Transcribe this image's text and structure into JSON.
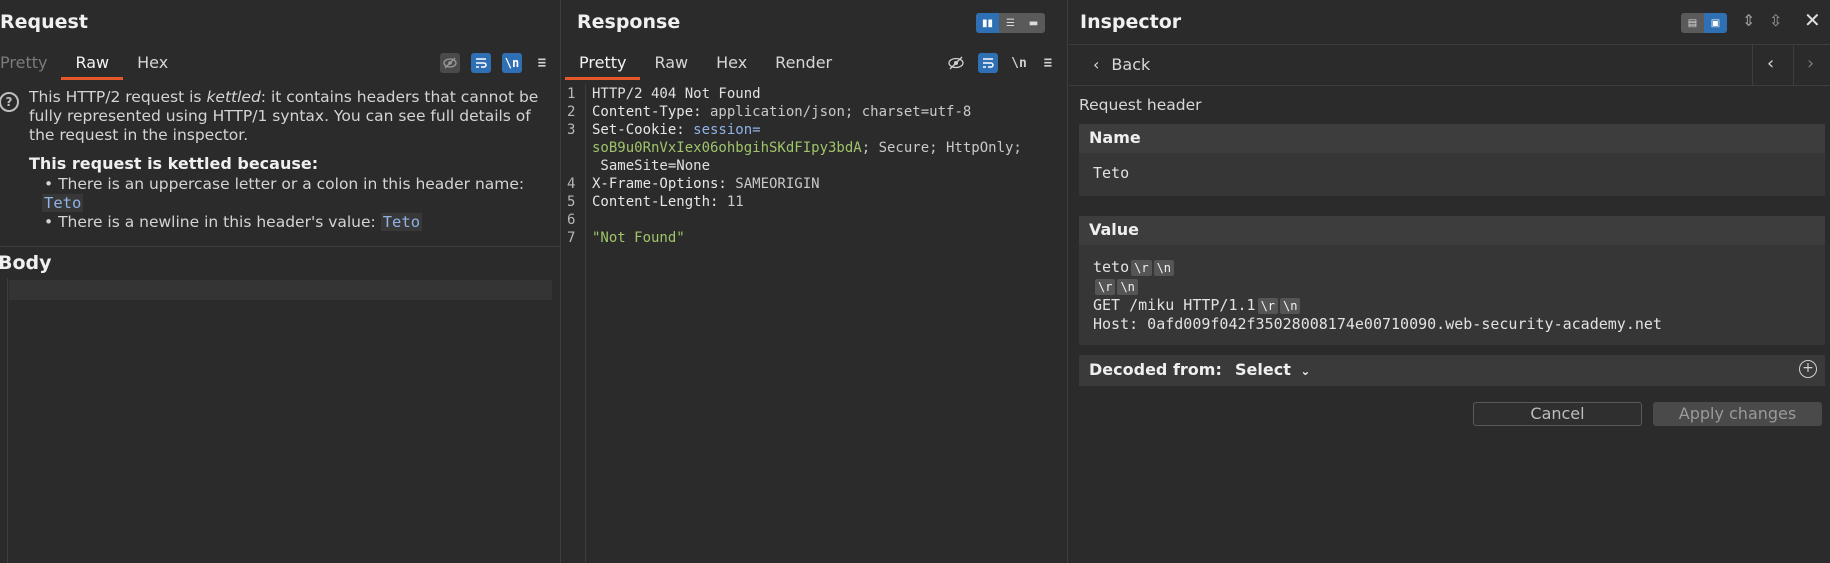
{
  "request": {
    "title": "Request",
    "tabs": [
      "Pretty",
      "Raw",
      "Hex"
    ],
    "active_tab": "Raw",
    "tools": {
      "wrap": "≡",
      "newline": "\\n",
      "menu": "≡"
    },
    "notice": {
      "line_a": "This HTTP/2 request is ",
      "kettled_word": "kettled",
      "line_b": ": it contains headers that cannot be fully represented using HTTP/1 syntax. You can see full details of the request in the inspector.",
      "reason_heading": "This request is kettled because:",
      "bullet1_text": "There is an uppercase letter or a colon in this header name:",
      "bullet1_code": "Teto",
      "bullet2_text": "There is a newline in this header's value:",
      "bullet2_code": "Teto"
    },
    "body_label": "Body"
  },
  "response": {
    "title": "Response",
    "tabs": [
      "Pretty",
      "Raw",
      "Hex",
      "Render"
    ],
    "active_tab": "Pretty",
    "tools": {
      "newline": "\\n",
      "menu": "≡"
    },
    "line_numbers": [
      "1",
      "2",
      "3",
      "4",
      "5",
      "6",
      "7"
    ],
    "lines": {
      "status": "HTTP/2 404 Not Found",
      "ct_name": "Content-Type:",
      "ct_value": " application/json; charset=utf-8",
      "sc_name": "Set-Cookie:",
      "sc_key": " session=",
      "sc_cookie": "soB9u0RnVxIex06ohbgihSKdFIpy3bdA",
      "sc_rest": "; Secure; HttpOnly;",
      "sc_rest2": " SameSite=None",
      "xfo_name": "X-Frame-Options:",
      "xfo_value": " SAMEORIGIN",
      "cl_name": "Content-Length:",
      "cl_value": " 11",
      "body": "\"Not Found\""
    }
  },
  "inspector": {
    "title": "Inspector",
    "back_label": "Back",
    "section_label": "Request header",
    "name_heading": "Name",
    "name_value": "Teto",
    "value_heading": "Value",
    "value_lines": {
      "l1": "teto",
      "l3": "GET /miku HTTP/1.1",
      "l4": "Host: 0afd009f042f35028008174e00710090.web-security-academy.net"
    },
    "esc_r": "\\r",
    "esc_n": "\\n",
    "decoded_label": "Decoded from:",
    "decoded_select": "Select",
    "cancel_label": "Cancel",
    "apply_label": "Apply changes"
  }
}
